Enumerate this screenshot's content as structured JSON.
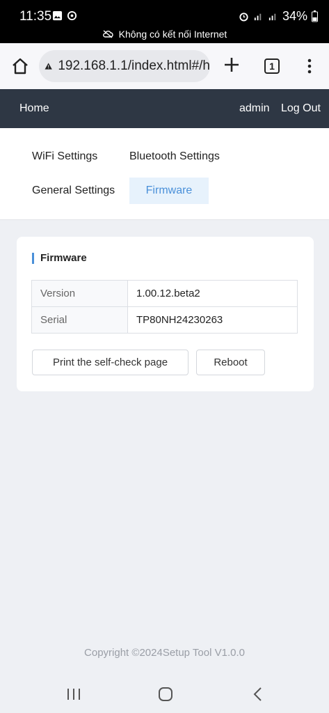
{
  "status_bar": {
    "time": "11:35",
    "battery": "34%",
    "network_message": "Không có kết nối Internet"
  },
  "browser": {
    "url": "192.168.1.1/index.html#/h",
    "tab_count": "1"
  },
  "app_nav": {
    "home": "Home",
    "user": "admin",
    "logout": "Log Out"
  },
  "tabs": [
    {
      "label": "WiFi Settings"
    },
    {
      "label": "Bluetooth Settings"
    },
    {
      "label": "General Settings"
    },
    {
      "label": "Firmware"
    }
  ],
  "firmware": {
    "title": "Firmware",
    "rows": [
      {
        "key": "Version",
        "value": "1.00.12.beta2"
      },
      {
        "key": "Serial",
        "value": "TP80NH24230263"
      }
    ],
    "print_button": "Print the self-check page",
    "reboot_button": "Reboot"
  },
  "footer": {
    "copyright": "Copyright ©2024Setup Tool V1.0.0"
  },
  "colors": {
    "nav_bg": "#2e3744",
    "accent": "#4a90d9",
    "page_bg": "#eef0f4"
  }
}
